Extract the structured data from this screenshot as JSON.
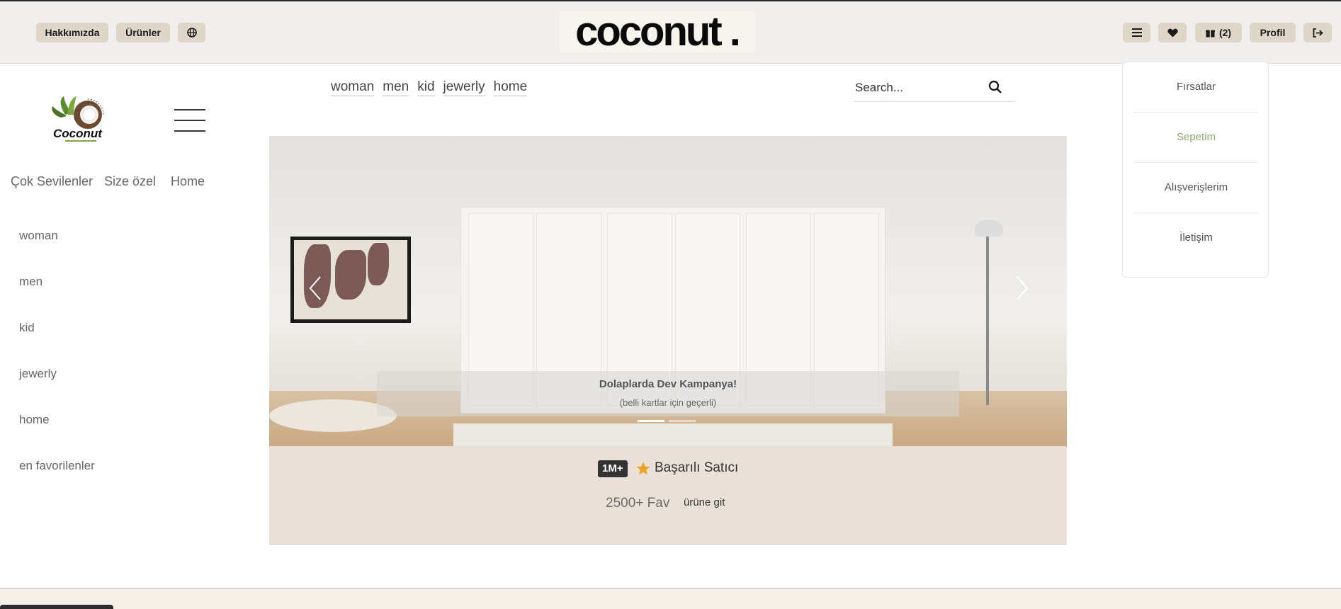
{
  "topbar": {
    "about_label": "Hakkımızda",
    "products_label": "Ürünler",
    "brand": "coconut .",
    "cart_label": "(2)",
    "profile_label": "Profil"
  },
  "dropdown": {
    "items": [
      "Fırsatlar",
      "Sepetim",
      "Alışverişlerim",
      "İletişim"
    ],
    "active_color": "#8aa86e"
  },
  "sidebar": {
    "logo_text": "Coconut",
    "quick_links": [
      "Çok Sevilenler",
      "Size özel",
      "Home"
    ],
    "categories": [
      "woman",
      "men",
      "kid",
      "jewerly",
      "home",
      "en favorilenler"
    ]
  },
  "category_nav": [
    "woman",
    "men",
    "kid",
    "jewerly",
    "home"
  ],
  "search": {
    "placeholder": "Search..."
  },
  "carousel": {
    "caption_title": "Dolaplarda Dev Kampanya!",
    "caption_subtitle": "(belli kartlar için geçerli)",
    "slides_count": 2,
    "active_slide": 1
  },
  "info_card": {
    "badge": "1M+",
    "seller_label": "Başarılı Satıcı",
    "fav_label": "2500+ Fav",
    "go_label": "ürüne git",
    "star_color": "#f0a020"
  }
}
